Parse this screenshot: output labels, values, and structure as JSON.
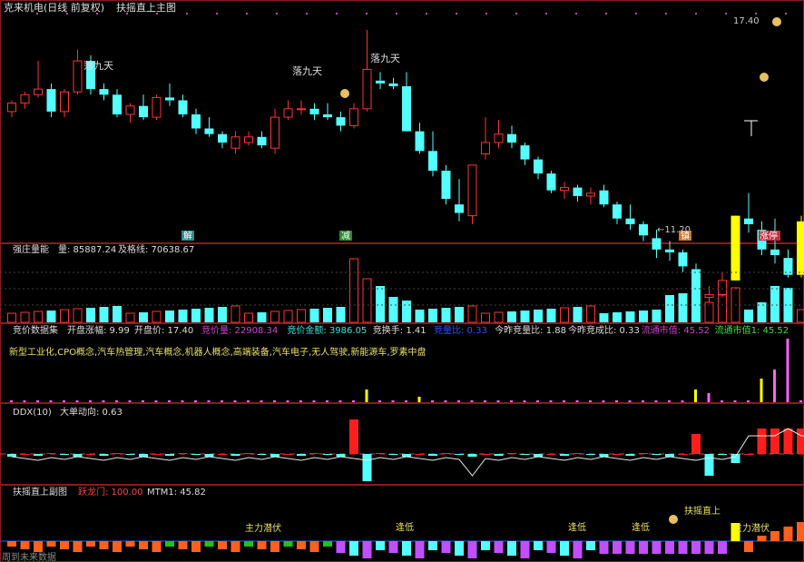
{
  "header": {
    "title": "克来机电(日线 前复权)",
    "subtitle": "扶摇直上主图",
    "last_price_label": "17.40",
    "low_price_label": "←11.20",
    "signals": [
      "落九天",
      "落九天",
      "落九天"
    ],
    "markers": {
      "jie": "解",
      "jian": "减",
      "zhen": "镇",
      "zhangting": "涨停"
    }
  },
  "volume_panel": {
    "title": "强庄量能",
    "vol_label": "量: 85887.24",
    "pass_label": "及格线: 70638.67"
  },
  "auction_panel": {
    "title": "竞价数据集",
    "items": [
      {
        "text": "开盘涨幅: 9.99",
        "color": "#dcdcdc"
      },
      {
        "text": "开盘价: 17.40",
        "color": "#dcdcdc"
      },
      {
        "text": "竞价量: 22908.34",
        "color": "#d040d0"
      },
      {
        "text": "竞价金额: 3986.05",
        "color": "#40e0e0"
      },
      {
        "text": "竞换手: 1.41",
        "color": "#dcdcdc"
      },
      {
        "text": "竞量比: 0.33",
        "color": "#3050ff"
      },
      {
        "text": "今昨竞量比: 1.88",
        "color": "#dcdcdc"
      },
      {
        "text": "今昨竞成比: 0.33",
        "color": "#dcdcdc"
      },
      {
        "text": "流通市值: 45.52",
        "color": "#d040d0"
      },
      {
        "text": "流通市值1: 45.52",
        "color": "#40e040"
      }
    ],
    "concepts": "新型工业化,CPO概念,汽车热管理,汽车概念,机器人概念,高端装备,汽车电子,无人驾驶,新能源车,罗素中盘"
  },
  "ddx_panel": {
    "title": "DDX(10)",
    "value_label": "大单动向: 0.63"
  },
  "sub_panel": {
    "title": "扶摇直上副图",
    "yuelong_label": "跃龙门: 100.00",
    "mtm_label": "MTM1: 45.82",
    "labels": [
      "主力潜伏",
      "逢低",
      "逢低",
      "逢低",
      "扶摇直上",
      "主力潜伏"
    ],
    "footer": "周到未来数据"
  },
  "colors": {
    "up": "#ff3232",
    "down": "#54ffff",
    "yellow": "#ffff00",
    "magenta": "#ff60ff",
    "gold": "#e8c060"
  },
  "chart_data": [
    {
      "type": "candlestick",
      "title": "克来机电(日线 前复权)",
      "ohlc": [
        [
          14.55,
          14.75,
          14.45,
          14.7
        ],
        [
          14.7,
          14.9,
          14.6,
          14.85
        ],
        [
          14.85,
          15.45,
          14.8,
          14.95
        ],
        [
          14.95,
          15.05,
          14.45,
          14.55
        ],
        [
          14.55,
          14.95,
          14.45,
          14.9
        ],
        [
          14.9,
          15.65,
          14.85,
          15.45
        ],
        [
          15.45,
          15.55,
          14.85,
          14.95
        ],
        [
          14.95,
          15.05,
          14.75,
          14.85
        ],
        [
          14.85,
          14.95,
          14.45,
          14.5
        ],
        [
          14.5,
          14.7,
          14.35,
          14.65
        ],
        [
          14.65,
          14.85,
          14.4,
          14.45
        ],
        [
          14.45,
          14.85,
          14.4,
          14.8
        ],
        [
          14.8,
          15.05,
          14.65,
          14.75
        ],
        [
          14.75,
          14.85,
          14.45,
          14.5
        ],
        [
          14.5,
          14.6,
          14.15,
          14.25
        ],
        [
          14.25,
          14.45,
          14.1,
          14.15
        ],
        [
          14.15,
          14.2,
          13.9,
          14.0
        ],
        [
          13.9,
          14.2,
          13.8,
          14.1
        ],
        [
          14.0,
          14.2,
          13.95,
          14.1
        ],
        [
          14.1,
          14.2,
          13.9,
          13.95
        ],
        [
          13.9,
          14.6,
          13.8,
          14.45
        ],
        [
          14.45,
          14.75,
          14.4,
          14.6
        ],
        [
          14.6,
          14.75,
          14.5,
          14.6
        ],
        [
          14.6,
          14.7,
          14.4,
          14.5
        ],
        [
          14.5,
          14.7,
          14.4,
          14.45
        ],
        [
          14.45,
          14.55,
          14.2,
          14.3
        ],
        [
          14.3,
          14.7,
          14.25,
          14.6
        ],
        [
          14.6,
          16.0,
          14.55,
          15.3
        ],
        [
          15.1,
          15.25,
          14.95,
          15.05
        ],
        [
          15.05,
          15.15,
          14.95,
          15.0
        ],
        [
          15.0,
          15.25,
          14.3,
          14.2
        ],
        [
          14.2,
          14.35,
          13.8,
          13.85
        ],
        [
          13.85,
          14.2,
          13.4,
          13.5
        ],
        [
          13.5,
          13.6,
          12.9,
          13.0
        ],
        [
          12.9,
          13.35,
          12.6,
          12.75
        ],
        [
          12.7,
          13.6,
          12.55,
          13.6
        ],
        [
          13.8,
          14.45,
          13.7,
          14.0
        ],
        [
          14.0,
          14.4,
          13.9,
          14.15
        ],
        [
          14.15,
          14.3,
          13.9,
          14.0
        ],
        [
          13.95,
          14.0,
          13.6,
          13.7
        ],
        [
          13.7,
          13.75,
          13.35,
          13.45
        ],
        [
          13.45,
          13.5,
          13.1,
          13.15
        ],
        [
          13.15,
          13.3,
          13.0,
          13.2
        ],
        [
          13.2,
          13.25,
          12.95,
          13.05
        ],
        [
          13.05,
          13.2,
          12.9,
          13.1
        ],
        [
          13.15,
          13.25,
          12.85,
          12.9
        ],
        [
          12.9,
          12.95,
          12.55,
          12.65
        ],
        [
          12.65,
          12.9,
          12.45,
          12.55
        ],
        [
          12.55,
          12.6,
          12.25,
          12.35
        ],
        [
          12.3,
          12.45,
          11.95,
          12.1
        ],
        [
          12.1,
          12.25,
          11.9,
          12.05
        ],
        [
          12.05,
          12.1,
          11.7,
          11.8
        ],
        [
          11.75,
          11.85,
          11.2,
          11.25
        ],
        [
          11.25,
          11.45,
          11.15,
          11.3
        ],
        [
          11.3,
          11.7,
          11.25,
          11.55
        ],
        [
          11.55,
          12.7,
          11.55,
          12.7
        ],
        [
          12.65,
          13.1,
          12.4,
          12.55
        ],
        [
          12.45,
          12.6,
          12.0,
          12.1
        ],
        [
          12.1,
          12.65,
          11.85,
          12.0
        ],
        [
          11.95,
          12.1,
          11.6,
          11.65
        ],
        [
          11.65,
          12.7,
          11.6,
          12.6
        ],
        [
          13.1,
          13.6,
          12.7,
          13.05
        ]
      ]
    }
  ]
}
